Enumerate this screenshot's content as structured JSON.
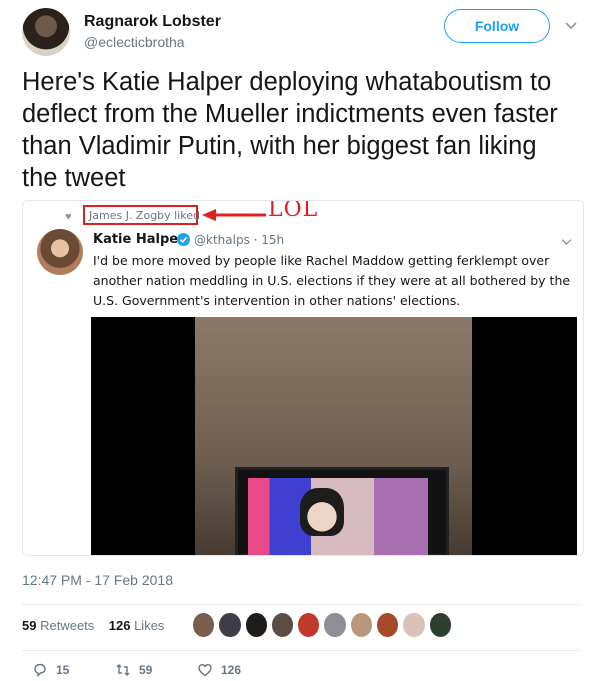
{
  "author": {
    "name": "Ragnarok Lobster",
    "handle": "@eclecticbrotha",
    "follow_label": "Follow"
  },
  "tweet": {
    "text": "Here's Katie Halper deploying whataboutism to deflect from the Mueller indictments even faster than Vladimir Putin, with her biggest fan liking the tweet",
    "timestamp": "12:47 PM - 17 Feb 2018"
  },
  "embedded": {
    "liked_by": "James J. Zogby liked",
    "annotation": "LOL",
    "author_name": "Katie Halper",
    "author_handle_time": "@kthalps · 15h",
    "text": "I'd be more moved by people like Rachel Maddow getting ferklempt over another nation meddling in U.S. elections if they were at all bothered by the U.S. Government's intervention in other nations' elections."
  },
  "stats": {
    "retweets_count": "59",
    "retweets_label": "Retweets",
    "likes_count": "126",
    "likes_label": "Likes"
  },
  "actions": {
    "replies": "15",
    "retweets": "59",
    "likes": "126"
  },
  "colors": {
    "accent": "#1da1f2",
    "annotation": "#e0201f",
    "secondary_text": "#657786"
  },
  "liker_colors": [
    "#7a5d4c",
    "#3e3e4a",
    "#1e1b19",
    "#5b4d42",
    "#c0392b",
    "#8d8f95",
    "#b9977b",
    "#a64a2c",
    "#d8c3b6",
    "#2d3e2f"
  ]
}
